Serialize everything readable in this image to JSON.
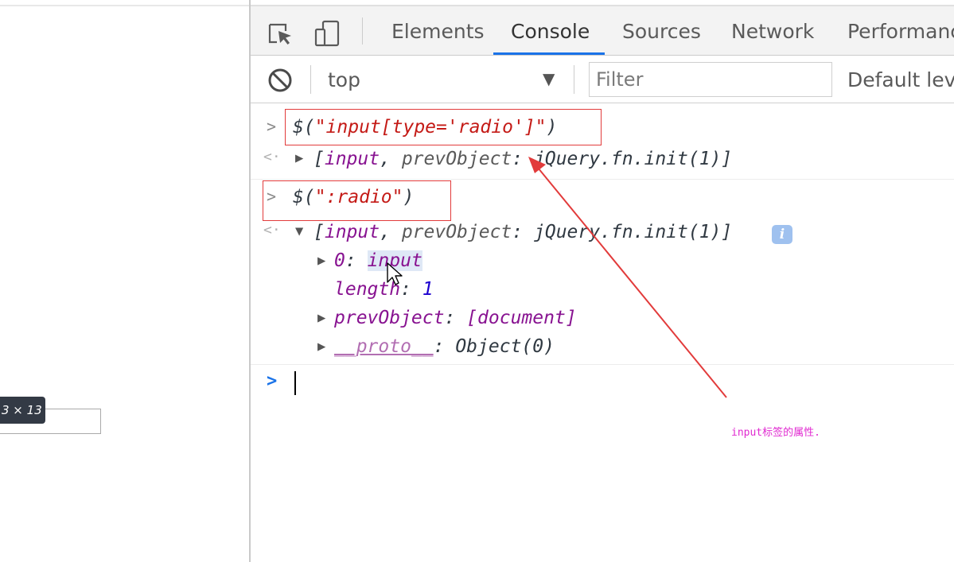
{
  "page": {
    "size_tooltip": "3 × 13"
  },
  "devtools": {
    "tabs": [
      {
        "label": "Elements",
        "active": false
      },
      {
        "label": "Console",
        "active": true
      },
      {
        "label": "Sources",
        "active": false
      },
      {
        "label": "Network",
        "active": false
      },
      {
        "label": "Performanc",
        "active": false
      }
    ],
    "toolbar": {
      "context": "top",
      "context_arrow": "▼",
      "filter_placeholder": "Filter",
      "levels_label": "Default leve"
    }
  },
  "console": {
    "entries": [
      {
        "kind": "command",
        "prefix": "$(",
        "string": "\"input[type='radio']\"",
        "suffix": ")"
      },
      {
        "kind": "result-collapsed",
        "open": "[",
        "item": "input",
        "comma": ", ",
        "key": "prevObject",
        "colon": ": ",
        "value": "jQuery.fn.init(1)",
        "close": "]"
      },
      {
        "kind": "command",
        "prefix": "$(",
        "string": "\":radio\"",
        "suffix": ")"
      },
      {
        "kind": "result-expanded",
        "open": "[",
        "item": "input",
        "comma": ", ",
        "key": "prevObject",
        "colon": ": ",
        "value": "jQuery.fn.init(1)",
        "close": "]",
        "info_badge": "i",
        "children": [
          {
            "key": "0",
            "colon": ": ",
            "value": "input"
          },
          {
            "key": "length",
            "colon": ": ",
            "value": "1"
          },
          {
            "key": "prevObject",
            "colon": ": ",
            "value": "[document]"
          },
          {
            "key": "__proto__",
            "colon": ": ",
            "value": "Object(0)"
          }
        ]
      }
    ]
  },
  "annotation": {
    "text": "input标签的属性.",
    "color": "#e02ad0"
  },
  "colors": {
    "red_box": "#e23b3b",
    "accent": "#1a73e8",
    "string": "#c41a16",
    "property": "#881391",
    "number": "#1c00cf"
  },
  "icons": {
    "inspect": "inspect-element-icon",
    "device": "device-toolbar-icon",
    "clear": "clear-console-icon",
    "info": "info-icon",
    "cursor": "mouse-cursor-icon"
  }
}
